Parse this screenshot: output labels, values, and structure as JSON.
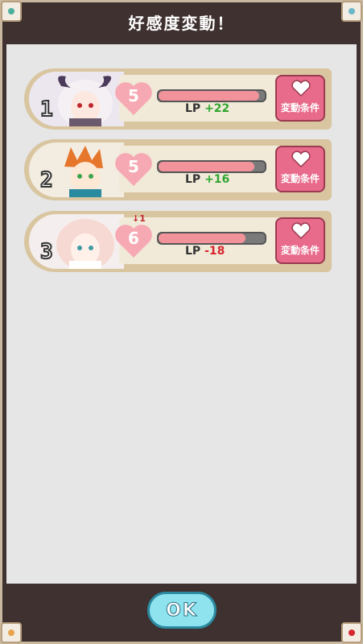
{
  "header": {
    "title": "好感度変動！"
  },
  "rows": [
    {
      "rank": "1",
      "heart_value": "5",
      "lp_label": "LP",
      "lp_delta": "+22",
      "delta_sign": "plus",
      "bar_fill": 0.95,
      "button_label": "変動条件",
      "arrow": ""
    },
    {
      "rank": "2",
      "heart_value": "5",
      "lp_label": "LP",
      "lp_delta": "+16",
      "delta_sign": "plus",
      "bar_fill": 0.9,
      "button_label": "変動条件",
      "arrow": ""
    },
    {
      "rank": "3",
      "heart_value": "6",
      "lp_label": "LP",
      "lp_delta": "-18",
      "delta_sign": "minus",
      "bar_fill": 0.82,
      "button_label": "変動条件",
      "arrow": "↓1"
    }
  ],
  "ok_button": {
    "label": "OK"
  },
  "colors": {
    "frame": "#3e312f",
    "panel": "#e6e6e6",
    "row": "#d9c6a1",
    "heart": "#f6a9b3",
    "button": "#e86b8b",
    "ok": "#8fe3ef"
  }
}
